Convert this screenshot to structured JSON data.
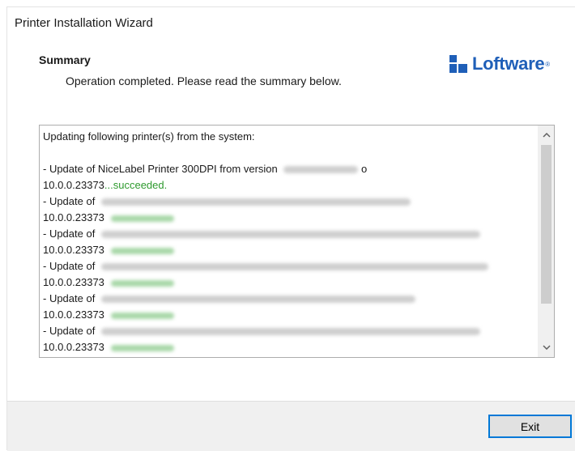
{
  "window": {
    "title": "Printer Installation Wizard"
  },
  "header": {
    "heading": "Summary",
    "subtitle": "Operation completed. Please read the summary below.",
    "logo_text": "Loftware",
    "logo_tm": "®",
    "brand_color": "#1f5fb8"
  },
  "log": {
    "intro": "Updating following printer(s) from the system:",
    "entries": [
      {
        "prefix": " - Update of NiceLabel Printer 300DPI from version",
        "suffix": "o",
        "version": "10.0.0.23373",
        "result": "...succeeded."
      },
      {
        "prefix": " - Update of",
        "version": "10.0.0.23373"
      },
      {
        "prefix": " - Update of",
        "version": "10.0.0.23373"
      },
      {
        "prefix": " - Update of",
        "version": "10.0.0.23373"
      },
      {
        "prefix": " - Update of",
        "version": "10.0.0.23373"
      },
      {
        "prefix": " - Update of",
        "version": "10.0.0.23373"
      }
    ],
    "success_color": "#2e9a2e"
  },
  "scrollbar": {
    "up_icon": "chevron-up-icon",
    "down_icon": "chevron-down-icon"
  },
  "footer": {
    "exit_label": "Exit"
  }
}
